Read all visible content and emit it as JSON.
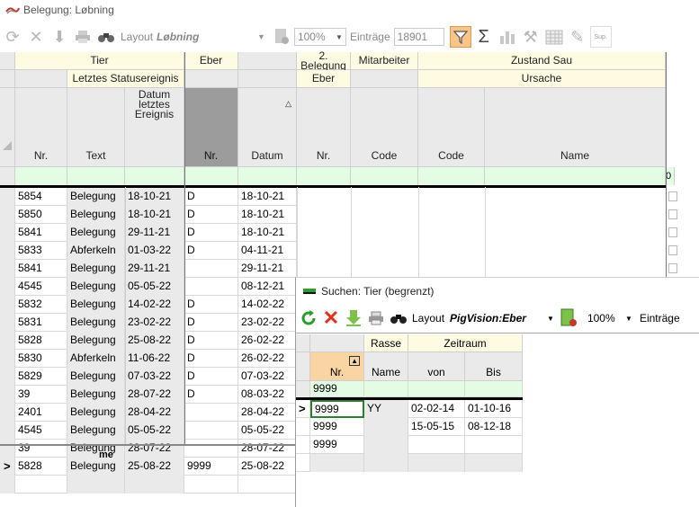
{
  "window": {
    "title": "Belegung: Løbning"
  },
  "toolbar": {
    "layout_label": "Layout",
    "layout_value": "Løbning",
    "zoom_value": "100%",
    "entries_label": "Einträge",
    "entries_value": "18901"
  },
  "grid": {
    "groups": {
      "tier": "Tier",
      "eber": "Eber",
      "second_mating": "2. Belegung",
      "employee": "Mitarbeiter",
      "sow_state": "Zustand Sau"
    },
    "subgroups": {
      "last_status": "Letztes Statusereignis",
      "eber_sub": "Eber",
      "cause": "Ursache"
    },
    "columns": {
      "nr": "Nr.",
      "text": "Text",
      "date_last": "Datum letztes Ereignis",
      "eber_nr": "Nr.",
      "datum": "Datum",
      "second_nr": "Nr.",
      "code": "Code",
      "state_code": "Code",
      "name": "Name"
    },
    "filter_extra": "0",
    "rows": [
      {
        "nr": "5854",
        "text": "Belegung",
        "last": "18-10-21",
        "eber": "D",
        "datum": "18-10-21"
      },
      {
        "nr": "5850",
        "text": "Belegung",
        "last": "18-10-21",
        "eber": "D",
        "datum": "18-10-21"
      },
      {
        "nr": "5841",
        "text": "Belegung",
        "last": "29-11-21",
        "eber": "D",
        "datum": "18-10-21"
      },
      {
        "nr": "5833",
        "text": "Abferkeln",
        "last": "01-03-22",
        "eber": "D",
        "datum": "04-11-21"
      },
      {
        "nr": "5841",
        "text": "Belegung",
        "last": "29-11-21",
        "eber": "",
        "datum": "29-11-21"
      },
      {
        "nr": "4545",
        "text": "Belegung",
        "last": "05-05-22",
        "eber": "",
        "datum": "08-12-21"
      },
      {
        "nr": "5832",
        "text": "Belegung",
        "last": "14-02-22",
        "eber": "D",
        "datum": "14-02-22"
      },
      {
        "nr": "5831",
        "text": "Belegung",
        "last": "23-02-22",
        "eber": "D",
        "datum": "23-02-22"
      },
      {
        "nr": "5828",
        "text": "Belegung",
        "last": "25-08-22",
        "eber": "D",
        "datum": "26-02-22"
      },
      {
        "nr": "5830",
        "text": "Abferkeln",
        "last": "11-06-22",
        "eber": "D",
        "datum": "26-02-22"
      },
      {
        "nr": "5829",
        "text": "Belegung",
        "last": "07-03-22",
        "eber": "D",
        "datum": "07-03-22"
      },
      {
        "nr": "39",
        "text": "Belegung",
        "last": "28-07-22",
        "eber": "D",
        "datum": "08-03-22"
      },
      {
        "nr": "2401",
        "text": "Belegung",
        "last": "28-04-22",
        "eber": "",
        "datum": "28-04-22"
      },
      {
        "nr": "4545",
        "text": "Belegung",
        "last": "05-05-22",
        "eber": "",
        "datum": "05-05-22"
      },
      {
        "nr": "39",
        "text": "Belegung",
        "last": "28-07-22",
        "eber": "",
        "datum": "28-07-22"
      },
      {
        "nr": "5828",
        "text": "Belegung",
        "last": "25-08-22",
        "eber": "9999",
        "datum": "25-08-22",
        "current": ">"
      }
    ],
    "footer_text": "me"
  },
  "popup": {
    "title": "Suchen: Tier (begrenzt)",
    "layout_label": "Layout",
    "layout_value": "PigVision:Eber",
    "zoom_value": "100%",
    "entries_label": "Einträge",
    "headers": {
      "rasse": "Rasse",
      "zeitraum": "Zeitraum",
      "nr": "Nr.",
      "name": "Name",
      "von": "von",
      "bis": "Bis"
    },
    "filter_value": "9999",
    "rows": [
      {
        "indicator": ">",
        "nr": "9999",
        "name": "YY",
        "von": "02-02-14",
        "bis": "01-10-16"
      },
      {
        "indicator": "",
        "nr": "9999",
        "name": "",
        "von": "15-05-15",
        "bis": "08-12-18"
      },
      {
        "indicator": "",
        "nr": "9999",
        "name": "",
        "von": "",
        "bis": ""
      }
    ]
  },
  "colors": {
    "header_bg": "#fffbe3",
    "filter_bg": "#e4fce4",
    "active_icon": "#f7c48a",
    "sort_col": "#fbd4a4"
  }
}
